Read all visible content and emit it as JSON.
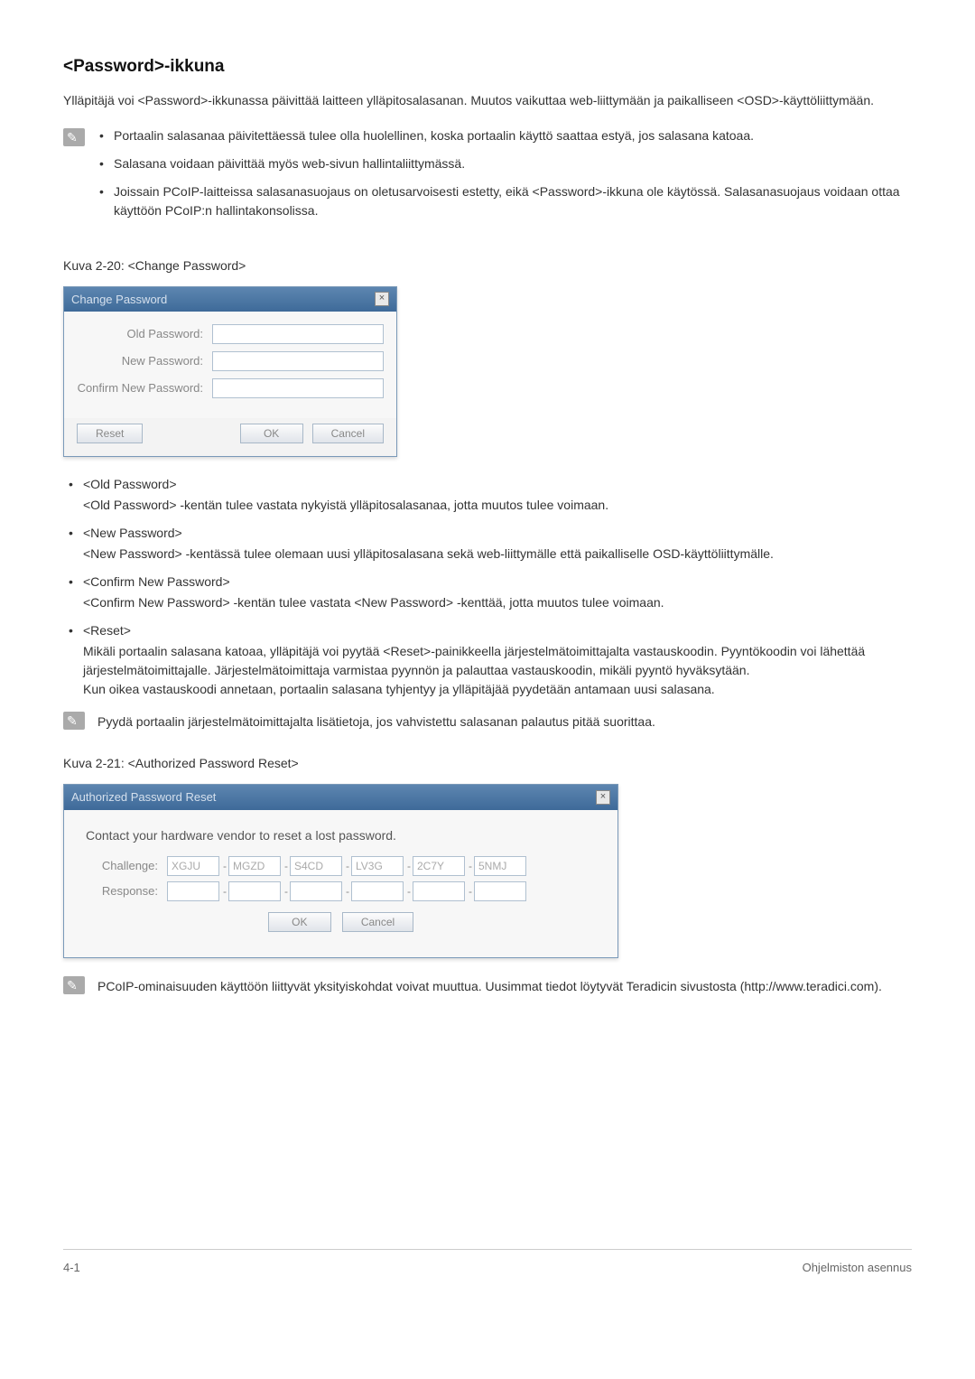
{
  "title": "<Password>-ikkuna",
  "intro": "Ylläpitäjä voi <Password>-ikkunassa päivittää laitteen ylläpitosalasanan. Muutos vaikuttaa web-liittymään ja paikalliseen <OSD>-käyttöliittymään.",
  "notes1": [
    "Portaalin salasanaa päivitettäessä tulee olla huolellinen, koska portaalin käyttö saattaa estyä, jos salasana katoaa.",
    "Salasana voidaan päivittää myös web-sivun hallintaliittymässä.",
    "Joissain PCoIP-laitteissa salasanasuojaus on oletusarvoisesti estetty, eikä <Password>-ikkuna ole käytössä. Salasanasuojaus voidaan ottaa käyttöön PCoIP:n hallintakonsolissa."
  ],
  "fig1_caption": "Kuva 2-20: <Change Password>",
  "dialog1": {
    "title": "Change Password",
    "close": "×",
    "old_label": "Old Password:",
    "new_label": "New Password:",
    "confirm_label": "Confirm New Password:",
    "reset": "Reset",
    "ok": "OK",
    "cancel": "Cancel"
  },
  "defs": [
    {
      "term": "<Old Password>",
      "desc": "<Old Password> -kentän tulee vastata nykyistä ylläpitosalasanaa, jotta muutos tulee voimaan."
    },
    {
      "term": "<New Password>",
      "desc": "<New Password> -kentässä tulee olemaan uusi ylläpitosalasana sekä web-liittymälle että paikalliselle OSD-käyttöliittymälle."
    },
    {
      "term": "<Confirm New Password>",
      "desc": "<Confirm New Password> -kentän tulee vastata <New Password> -kenttää, jotta muutos tulee voimaan."
    },
    {
      "term": "<Reset>",
      "desc": "Mikäli portaalin salasana katoaa, ylläpitäjä voi pyytää <Reset>-painikkeella järjestelmätoimittajalta vastauskoodin. Pyyntökoodin voi lähettää järjestelmätoimittajalle. Järjestelmätoimittaja varmistaa pyynnön ja palauttaa vastauskoodin, mikäli pyyntö hyväksytään.",
      "desc2": "Kun oikea vastauskoodi annetaan, portaalin salasana tyhjentyy ja ylläpitäjää pyydetään antamaan uusi salasana."
    }
  ],
  "note2": "Pyydä portaalin järjestelmätoimittajalta lisätietoja, jos vahvistettu salasanan palautus pitää suorittaa.",
  "fig2_caption": "Kuva 2-21: <Authorized Password Reset>",
  "dialog2": {
    "title": "Authorized Password Reset",
    "close": "×",
    "instruction": "Contact your hardware vendor to reset a lost password.",
    "challenge_label": "Challenge:",
    "response_label": "Response:",
    "challenge": [
      "XGJU",
      "MGZD",
      "S4CD",
      "LV3G",
      "2C7Y",
      "5NMJ"
    ],
    "ok": "OK",
    "cancel": "Cancel"
  },
  "note3": "PCoIP-ominaisuuden käyttöön liittyvät yksityiskohdat voivat muuttua. Uusimmat tiedot löytyvät Teradicin sivustosta (http://www.teradici.com).",
  "footer_left": "4-1",
  "footer_right": "Ohjelmiston asennus"
}
